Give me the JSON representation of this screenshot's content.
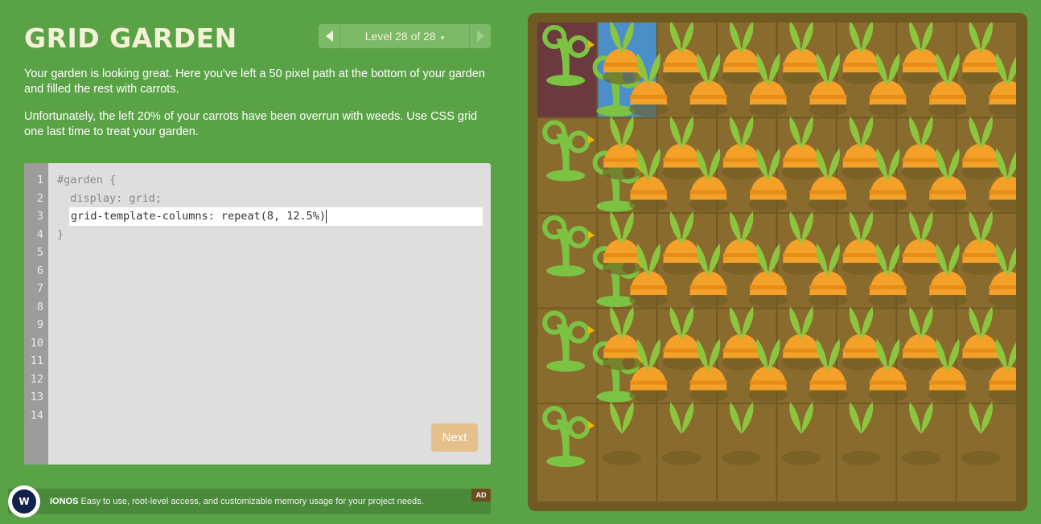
{
  "header": {
    "title": "GRID GARDEN",
    "level_label": "Level 28 of 28",
    "caret": "▾"
  },
  "instructions": {
    "p1": "Your garden is looking great. Here you've left a 50 pixel path at the bottom of your garden and filled the rest with carrots.",
    "p2": "Unfortunately, the left 20% of your carrots have been overrun with weeds. Use CSS grid one last time to treat your garden."
  },
  "editor": {
    "line_numbers": [
      "1",
      "2",
      "3",
      "4",
      "5",
      "6",
      "7",
      "8",
      "9",
      "10",
      "11",
      "12",
      "13",
      "14"
    ],
    "line1": "#garden {",
    "line2": "  display: grid;",
    "input_value": "grid-template-columns: repeat(8, 12.5%)",
    "line4": "}",
    "next_label": "Next"
  },
  "ad": {
    "logo": "W",
    "brand": "IONOS",
    "text": "Easy to use, root-level access, and customizable memory usage for your project needs.",
    "badge": "AD"
  },
  "garden": {
    "columns": 8,
    "rows": 5,
    "colors": {
      "soil": "#8a6b2e",
      "soil_line": "#6f5a22",
      "treatment_poison": "#6a3a3e",
      "treatment_water": "#4a8fc8",
      "carrot": "#f4a12a",
      "leaf": "#8cc63f",
      "weed": "#7cc243"
    }
  }
}
